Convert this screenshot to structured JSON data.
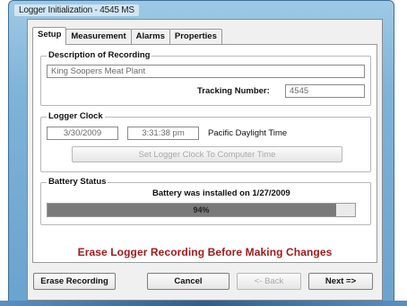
{
  "window": {
    "title": "Logger Initialization - 4545 MS"
  },
  "tabs": [
    {
      "label": "Setup",
      "active": true
    },
    {
      "label": "Measurement",
      "active": false
    },
    {
      "label": "Alarms",
      "active": false
    },
    {
      "label": "Properties",
      "active": false
    }
  ],
  "description": {
    "group_label": "Description of Recording",
    "value": "King Soopers Meat Plant",
    "tracking_label": "Tracking Number:",
    "tracking_value": "4545"
  },
  "clock": {
    "group_label": "Logger Clock",
    "date": "3/30/2009",
    "time": "3:31:38 pm",
    "timezone": "Pacific Daylight Time",
    "set_button": "Set Logger Clock To Computer Time"
  },
  "battery": {
    "group_label": "Battery Status",
    "installed_text": "Battery was installed on 1/27/2009",
    "level_text": "94%",
    "level_fraction": 0.94
  },
  "warning": "Erase Logger Recording Before Making Changes",
  "buttons": {
    "erase": "Erase Recording",
    "cancel": "Cancel",
    "back": "<- Back",
    "next": "Next =>"
  },
  "colors": {
    "warning": "#a31a1a",
    "progress_fill": "#7a7a7a",
    "titlebar": "#7fb3d8"
  }
}
